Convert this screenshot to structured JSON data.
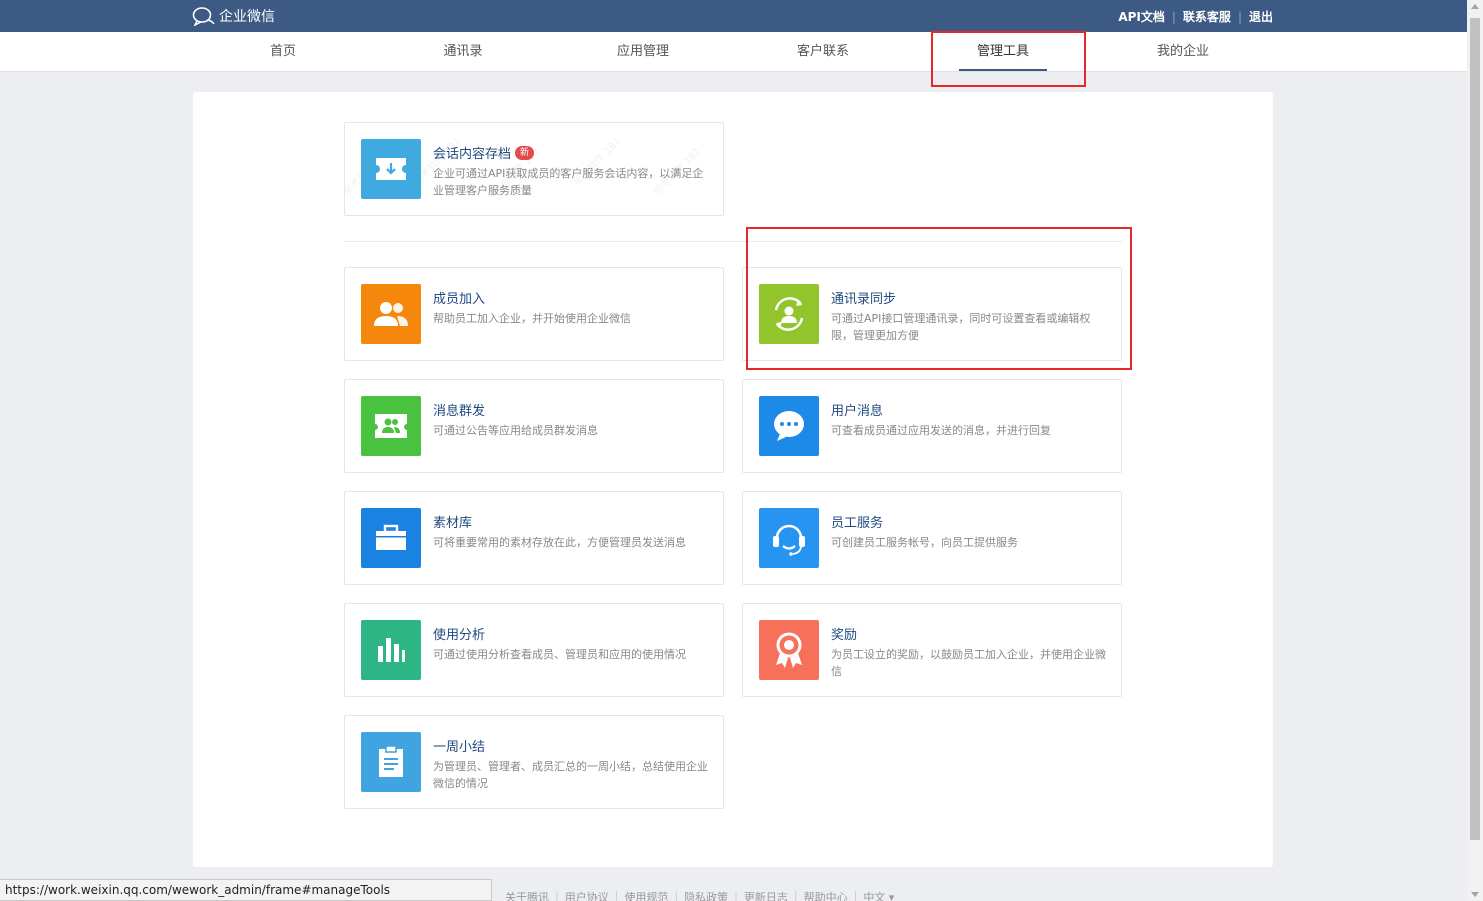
{
  "header": {
    "logo_text": "企业微信",
    "links": [
      "API文档",
      "联系客服",
      "退出"
    ]
  },
  "nav": {
    "items": [
      "首页",
      "通讯录",
      "应用管理",
      "客户联系",
      "管理工具",
      "我的企业"
    ],
    "active": "管理工具"
  },
  "featured": {
    "title": "会话内容存档",
    "badge": "新",
    "desc": "企业可通过API获取成员的客户服务会话内容，以满足企业管理客户服务质量"
  },
  "tools": [
    {
      "title": "成员加入",
      "desc": "帮助员工加入企业，并开始使用企业微信",
      "icon": "members-join-icon",
      "color": "#f5880c"
    },
    {
      "title": "通讯录同步",
      "desc": "可通过API接口管理通讯录，同时可设置查看或编辑权限，管理更加方便",
      "icon": "contacts-sync-icon",
      "color": "#91c52b"
    },
    {
      "title": "消息群发",
      "desc": "可通过公告等应用给成员群发消息",
      "icon": "broadcast-message-icon",
      "color": "#49c33f"
    },
    {
      "title": "用户消息",
      "desc": "可查看成员通过应用发送的消息，并进行回复",
      "icon": "chat-bubble-icon",
      "color": "#1e8ae8"
    },
    {
      "title": "素材库",
      "desc": "可将重要常用的素材存放在此，方便管理员发送消息",
      "icon": "briefcase-icon",
      "color": "#1a82e0"
    },
    {
      "title": "员工服务",
      "desc": "可创建员工服务帐号，向员工提供服务",
      "icon": "headset-icon",
      "color": "#2894f2"
    },
    {
      "title": "使用分析",
      "desc": "可通过使用分析查看成员、管理员和应用的使用情况",
      "icon": "bar-chart-icon",
      "color": "#2db585"
    },
    {
      "title": "奖励",
      "desc": "为员工设立的奖励，以鼓励员工加入企业，并使用企业微信",
      "icon": "award-icon",
      "color": "#f6705a"
    },
    {
      "title": "一周小结",
      "desc": "为管理员、管理者、成员汇总的一周小结，总结使用企业微信的情况",
      "icon": "clipboard-icon",
      "color": "#3fa4e0"
    }
  ],
  "status_url": "https://work.weixin.qq.com/wework_admin/frame#manageTools",
  "footer": [
    "关于腾讯",
    "用户协议",
    "使用规范",
    "隐私政策",
    "更新日志",
    "帮助中心",
    "中文 ▾"
  ],
  "colors": {
    "topbar": "#3c5a83",
    "highlight": "#e5282b",
    "title": "#1f4a80"
  }
}
